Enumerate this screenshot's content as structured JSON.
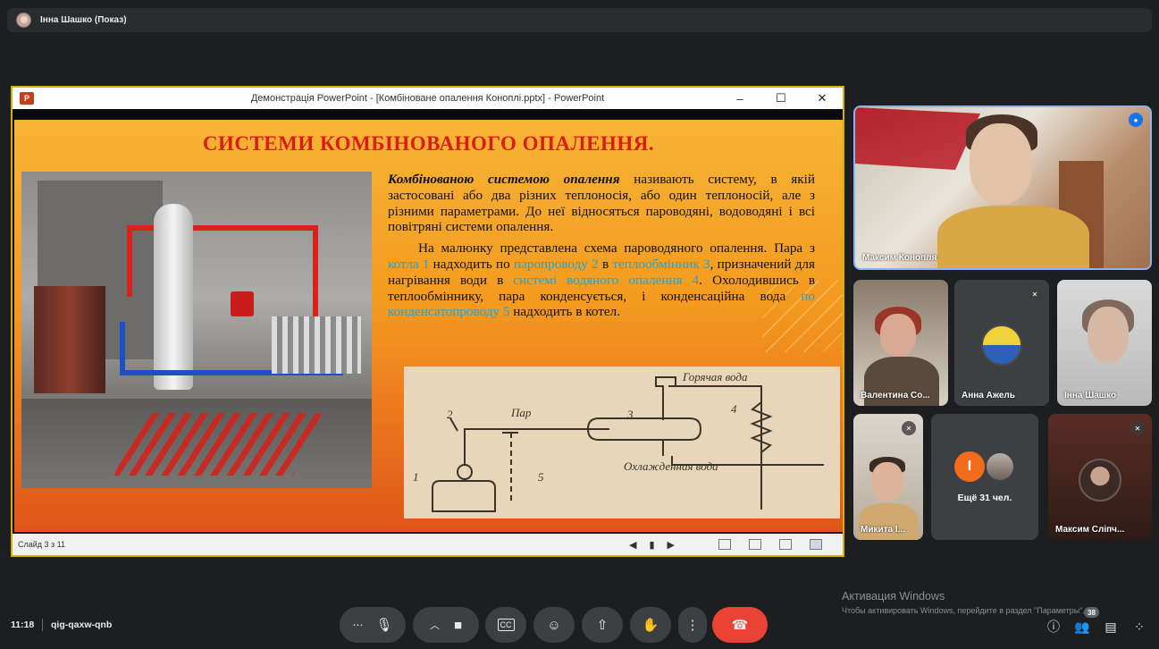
{
  "header": {
    "presenter_label": "Інна Шашко (Показ)"
  },
  "powerpoint": {
    "window_title": "Демонстрація PowerPoint - [Комбіноване опалення Коноплі.pptx] - PowerPoint",
    "logo_letter": "P",
    "minimize": "–",
    "maximize": "☐",
    "close": "✕",
    "status_slide": "Слайд 3 з 11",
    "nav_prev": "◀",
    "nav_menu": "▮",
    "nav_next": "▶"
  },
  "slide": {
    "title": "СИСТЕМИ КОМБІНОВАНОГО ОПАЛЕННЯ.",
    "p1_term": "Комбінованою системою опалення",
    "p1_rest": " називають систему, в якій застосовані або два різних теплоносія, або один теплоносій, але з різними параметрами. До неї відносяться пароводяні, водоводяні і всі повітряні системи опалення.",
    "p2_a": "На малюнку представлена схема пароводяного опалення. Пара з ",
    "p2_hl1": "котла 1",
    "p2_b": " надходить по ",
    "p2_hl2": "паропроводу 2",
    "p2_c": " в ",
    "p2_hl3": "теплообмінник 3",
    "p2_d": ", призначений для нагрівання води в ",
    "p2_hl4": "системі водяного опалення 4",
    "p2_e": ". Охолодившись в теплообміннику, пара конденсується, і конденсаційна вода ",
    "p2_hl5": "по конденсатопроводу 5",
    "p2_f": " надходить в котел.",
    "diagram": {
      "hot_water": "Горячая вода",
      "steam": "Пар",
      "cooled_water": "Охлажденная вода",
      "n1": "1",
      "n2": "2",
      "n3": "3",
      "n4": "4",
      "n5": "5"
    }
  },
  "participants": [
    {
      "name": "Максим Конопля",
      "state": "speaking"
    },
    {
      "name": "Валентина Со...",
      "state": "video"
    },
    {
      "name": "Анна Ажель",
      "state": "muted"
    },
    {
      "name": "Інна Шашко",
      "state": "video"
    },
    {
      "name": "Микита І...",
      "state": "muted"
    },
    {
      "name": "Максим Сліпч...",
      "state": "muted"
    }
  ],
  "more_tile": {
    "label": "Ещё 31 чел.",
    "initial": "I"
  },
  "watermark": {
    "title": "Активация Windows",
    "subtitle": "Чтобы активировать Windows, перейдите в раздел \"Параметры\"."
  },
  "bottom": {
    "time": "11:18",
    "meeting_code": "qig-qaxw-qnb",
    "people_count": "38"
  },
  "colors": {
    "accent_blue": "#8ab4f8",
    "end_call": "#ea4335",
    "slide_title": "#d81e16",
    "link": "#1ea4d8"
  }
}
